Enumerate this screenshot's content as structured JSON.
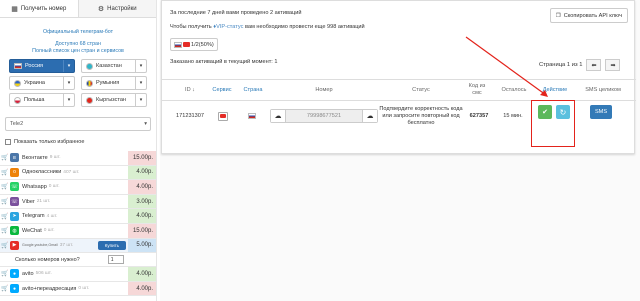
{
  "left_panel": {
    "tabs": [
      {
        "label": "Получить номер",
        "icon": "grid-icon"
      },
      {
        "label": "Настройки",
        "icon": "gear-icon"
      }
    ],
    "info": {
      "official_bot": "Официальный телеграм-бот",
      "available": "Доступно 68 стран",
      "full_list": "Полный список цен стран и сервисов"
    },
    "countries": [
      {
        "name": "Россия",
        "flag": "ru",
        "selected": true
      },
      {
        "name": "Казахстан",
        "flag": "kz",
        "selected": false
      },
      {
        "name": "Украина",
        "flag": "ua",
        "selected": false
      },
      {
        "name": "Румыния",
        "flag": "ro",
        "selected": false
      },
      {
        "name": "Польша",
        "flag": "pl",
        "selected": false
      },
      {
        "name": "Кыргызстан",
        "flag": "kg",
        "selected": false
      }
    ],
    "operator": "Tele2",
    "favorites_label": "Показать только избранное",
    "services": [
      {
        "name": "Вконтакте",
        "count": "9 шт.",
        "price": "15.00р.",
        "price_color": "red",
        "icon_color": "#4a76a8",
        "icon_char": "vk"
      },
      {
        "name": "Одноклассники",
        "count": "407 шт.",
        "price": "4.00р.",
        "price_color": "green",
        "icon_color": "#ee8208",
        "icon_char": "ok"
      },
      {
        "name": "Whatsapp",
        "count": "0 шт.",
        "price": "4.00р.",
        "price_color": "red",
        "icon_color": "#25d366",
        "icon_char": "w"
      },
      {
        "name": "Viber",
        "count": "21 шт.",
        "price": "3.00р.",
        "price_color": "green",
        "icon_color": "#7b519d",
        "icon_char": "v"
      },
      {
        "name": "Telegram",
        "count": "4 шт.",
        "price": "4.00р.",
        "price_color": "green",
        "icon_color": "#2ca5e0",
        "icon_char": "t"
      },
      {
        "name": "WeChat",
        "count": "0 шт.",
        "price": "15.00р.",
        "price_color": "red",
        "icon_color": "#09b83e",
        "icon_char": "wc"
      }
    ],
    "expanded_service": {
      "name": "Google,youtube,Gmail",
      "count": "37 шт.",
      "buy_label": "Купить",
      "price": "5.00р."
    },
    "quantity": {
      "label": "Сколько номеров нужно?",
      "value": "1"
    },
    "more_services": [
      {
        "name": "avito",
        "count": "506 шт.",
        "price": "4.00р.",
        "price_color": "green",
        "icon_color": "#00aaff"
      },
      {
        "name": "avito+переадресация",
        "count": "0 шт.",
        "price": "4.00р.",
        "price_color": "red",
        "icon_color": "#00aaff"
      }
    ]
  },
  "right_panel": {
    "stats_line": "За последние 7 дней вами проведено 2 активаций",
    "vip_prefix": "Чтобы получить ",
    "vip_link": "VIP-статус",
    "vip_suffix": " вам необходимо провести еще 998 активаций",
    "copy_api_label": "Скопировать API ключ",
    "counter_label": "1/2(50%)",
    "ordered_label": "Заказано активаций в текущий момент: 1",
    "pager_label": "Страница 1 из 1",
    "columns": {
      "id": "ID",
      "service": "Сервис",
      "country": "Страна",
      "number": "Номер",
      "status": "Статус",
      "code": "Код из смс",
      "left": "Осталось",
      "action": "Действие",
      "sms": "SMS целиком"
    },
    "row": {
      "id": "171231307",
      "number": "79998677521",
      "status": "Подтвердите корректность кода или запросите повторный код бесплатно",
      "code": "627357",
      "left": "15 мин.",
      "sms_button": "SMS"
    },
    "accent_color": "#337ab7",
    "annotation_color": "#e3231b"
  }
}
